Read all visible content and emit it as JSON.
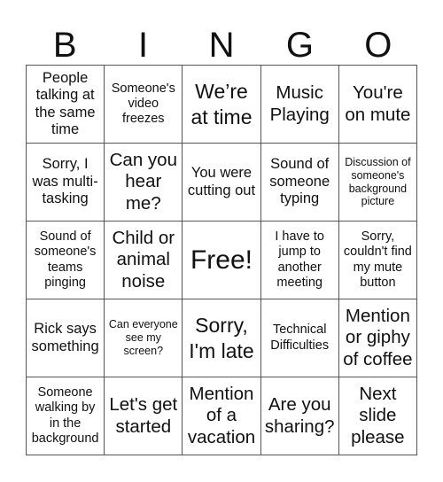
{
  "header": {
    "letters": [
      "B",
      "I",
      "N",
      "G",
      "O"
    ]
  },
  "grid": {
    "rows": [
      [
        {
          "text": "People talking at the same time",
          "size": "m"
        },
        {
          "text": "Someone's video freezes",
          "size": "s"
        },
        {
          "text": "We’re at time",
          "size": "xl"
        },
        {
          "text": "Music Playing",
          "size": "l"
        },
        {
          "text": "You're on mute",
          "size": "l"
        }
      ],
      [
        {
          "text": "Sorry, I was multi-tasking",
          "size": "m"
        },
        {
          "text": "Can you hear me?",
          "size": "l"
        },
        {
          "text": "You were cutting out",
          "size": "m"
        },
        {
          "text": "Sound of someone typing",
          "size": "m"
        },
        {
          "text": "Discussion of someone's background picture",
          "size": "xs"
        }
      ],
      [
        {
          "text": "Sound of someone's teams pinging",
          "size": "s"
        },
        {
          "text": "Child or animal noise",
          "size": "l"
        },
        {
          "text": "Free!",
          "size": "free"
        },
        {
          "text": "I have to jump to another meeting",
          "size": "s"
        },
        {
          "text": "Sorry, couldn't find my mute button",
          "size": "s"
        }
      ],
      [
        {
          "text": "Rick says something",
          "size": "m"
        },
        {
          "text": "Can everyone see my screen?",
          "size": "xs"
        },
        {
          "text": "Sorry, I'm late",
          "size": "xl"
        },
        {
          "text": "Technical Difficulties",
          "size": "s"
        },
        {
          "text": "Mention or giphy of coffee",
          "size": "l"
        }
      ],
      [
        {
          "text": "Someone walking by in the background",
          "size": "s"
        },
        {
          "text": "Let's get started",
          "size": "l"
        },
        {
          "text": "Mention of a vacation",
          "size": "l"
        },
        {
          "text": "Are you sharing?",
          "size": "l"
        },
        {
          "text": "Next slide please",
          "size": "l"
        }
      ]
    ]
  }
}
